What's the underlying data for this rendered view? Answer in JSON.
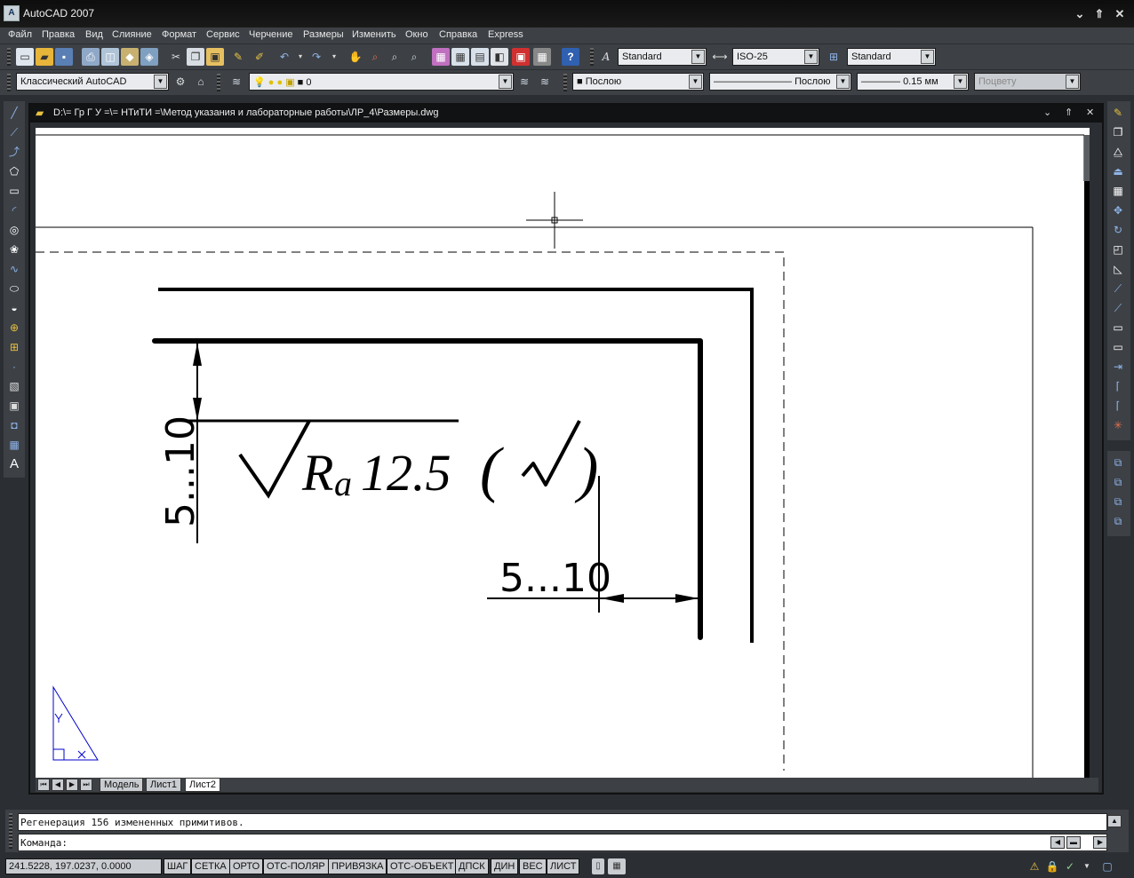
{
  "app": {
    "title": "AutoCAD 2007"
  },
  "window_controls": {
    "minimize": "⌄",
    "restore": "⇑",
    "close": "✕"
  },
  "menu": [
    "Файл",
    "Правка",
    "Вид",
    "Слияние",
    "Формат",
    "Сервис",
    "Черчение",
    "Размеры",
    "Изменить",
    "Окно",
    "Справка",
    "Express"
  ],
  "toolbar": {
    "text_style": "Standard",
    "dim_style": "ISO-25",
    "table_style": "Standard",
    "workspace": "Классический AutoCAD",
    "layer": "0",
    "color": "Послою",
    "linetype": "Послою",
    "lineweight": "0.15 мм",
    "plot_style": "Поцвету"
  },
  "document": {
    "title": "D:\\= Гр Г У =\\= НТиТИ =\\Метод указания и лабораторные работы\\ЛР_4\\Размеры.dwg"
  },
  "drawing": {
    "vertical_dim": "5...10",
    "horizontal_dim": "5...10",
    "roughness_symbol": "√",
    "roughness_r": "R",
    "roughness_a": "a",
    "roughness_value": "12.5",
    "paren_open": "(",
    "paren_close": ")",
    "check_symbol": "√"
  },
  "layout_tabs": [
    "Модель",
    "Лист1",
    "Лист2"
  ],
  "active_tab": "Лист2",
  "command": {
    "history": "Регенерация 156 измененных примитивов.",
    "prompt": "Команда:"
  },
  "status": {
    "coordinates": "241.5228, 197.0237, 0.0000",
    "toggles": [
      "ШАГ",
      "СЕТКА",
      "ОРТО",
      "ОТС-ПОЛЯР",
      "ПРИВЯЗКА",
      "ОТС-ОБЪЕКТ",
      "ДПСК",
      "ДИН",
      "ВЕС",
      "ЛИСТ"
    ]
  },
  "colors": {
    "ui_dark": "#3d4146",
    "canvas": "#ffffff",
    "ucs_icon": "#0000cc",
    "titlebar": "#0d0d0d"
  }
}
